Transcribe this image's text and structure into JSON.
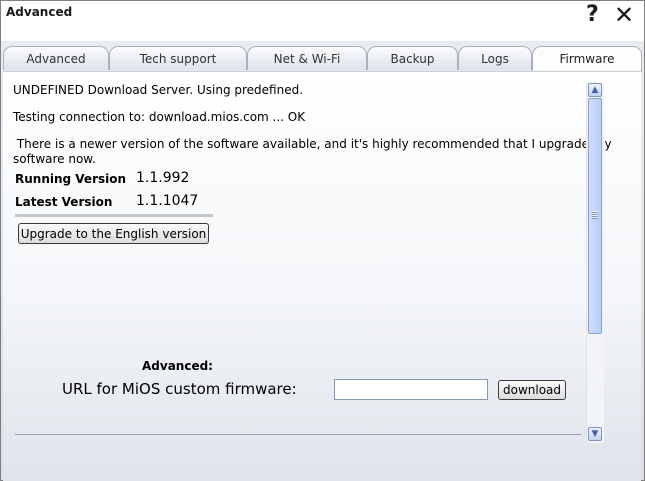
{
  "window": {
    "title": "Advanced",
    "help_glyph": "?",
    "close_glyph": "✕"
  },
  "tabs": [
    {
      "label": "Advanced",
      "active": false
    },
    {
      "label": "Tech support",
      "active": false
    },
    {
      "label": "Net & Wi-Fi",
      "active": false
    },
    {
      "label": "Backup",
      "active": false
    },
    {
      "label": "Logs",
      "active": false
    },
    {
      "label": "Firmware",
      "active": true
    }
  ],
  "firmware": {
    "status_line1": "UNDEFINED Download Server. Using predefined.",
    "status_line2": "Testing connection to: download.mios.com ... OK",
    "notice_line1": " There is a newer version of the software available, and it's highly recommended that I upgrade my",
    "notice_line2": "software now.",
    "running_label": "Running Version",
    "running_value": "1.1.992",
    "latest_label": "Latest Version",
    "latest_value": "1.1.1047",
    "upgrade_button": "Upgrade to the English version",
    "advanced_label": "Advanced:",
    "url_label": "URL for MiOS custom firmware:",
    "url_value": "",
    "download_button": "download"
  },
  "scrollbar": {
    "up_glyph": "▲",
    "down_glyph": "▼"
  },
  "colors": {
    "accent": "#7d93c0",
    "tab_border": "#a9b1bd"
  }
}
